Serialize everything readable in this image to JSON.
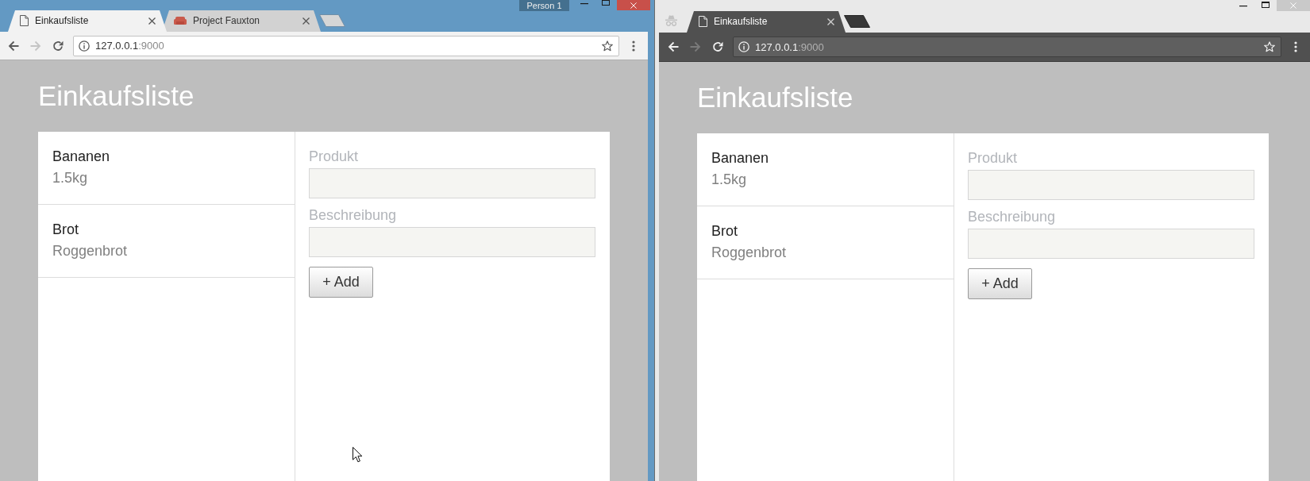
{
  "windows": [
    {
      "active": true,
      "incognito": false,
      "tabs": [
        {
          "kind": "document",
          "title": "Einkaufsliste",
          "selected": true
        },
        {
          "kind": "favicon",
          "title": "Project Fauxton",
          "selected": false
        }
      ],
      "profile": "Person 1",
      "toolbar": {
        "back_disabled": false,
        "forward_disabled": true
      },
      "address": {
        "host": "127.0.0.1",
        "port": ":9000"
      },
      "page": {
        "title": "Einkaufsliste",
        "items": [
          {
            "name": "Bananen",
            "description": "1.5kg"
          },
          {
            "name": "Brot",
            "description": "Roggenbrot"
          }
        ],
        "fields": [
          {
            "label": "Produkt"
          },
          {
            "label": "Beschreibung"
          }
        ],
        "button": "+ Add"
      },
      "pointer": true
    },
    {
      "active": false,
      "incognito": true,
      "tabs": [
        {
          "kind": "document",
          "title": "Einkaufsliste",
          "selected": true
        }
      ],
      "toolbar": {
        "back_disabled": false,
        "forward_disabled": true
      },
      "address": {
        "host": "127.0.0.1",
        "port": ":9000"
      },
      "page": {
        "title": "Einkaufsliste",
        "items": [
          {
            "name": "Bananen",
            "description": "1.5kg"
          },
          {
            "name": "Brot",
            "description": "Roggenbrot"
          }
        ],
        "fields": [
          {
            "label": "Produkt"
          },
          {
            "label": "Beschreibung"
          }
        ],
        "button": "+ Add"
      }
    }
  ]
}
